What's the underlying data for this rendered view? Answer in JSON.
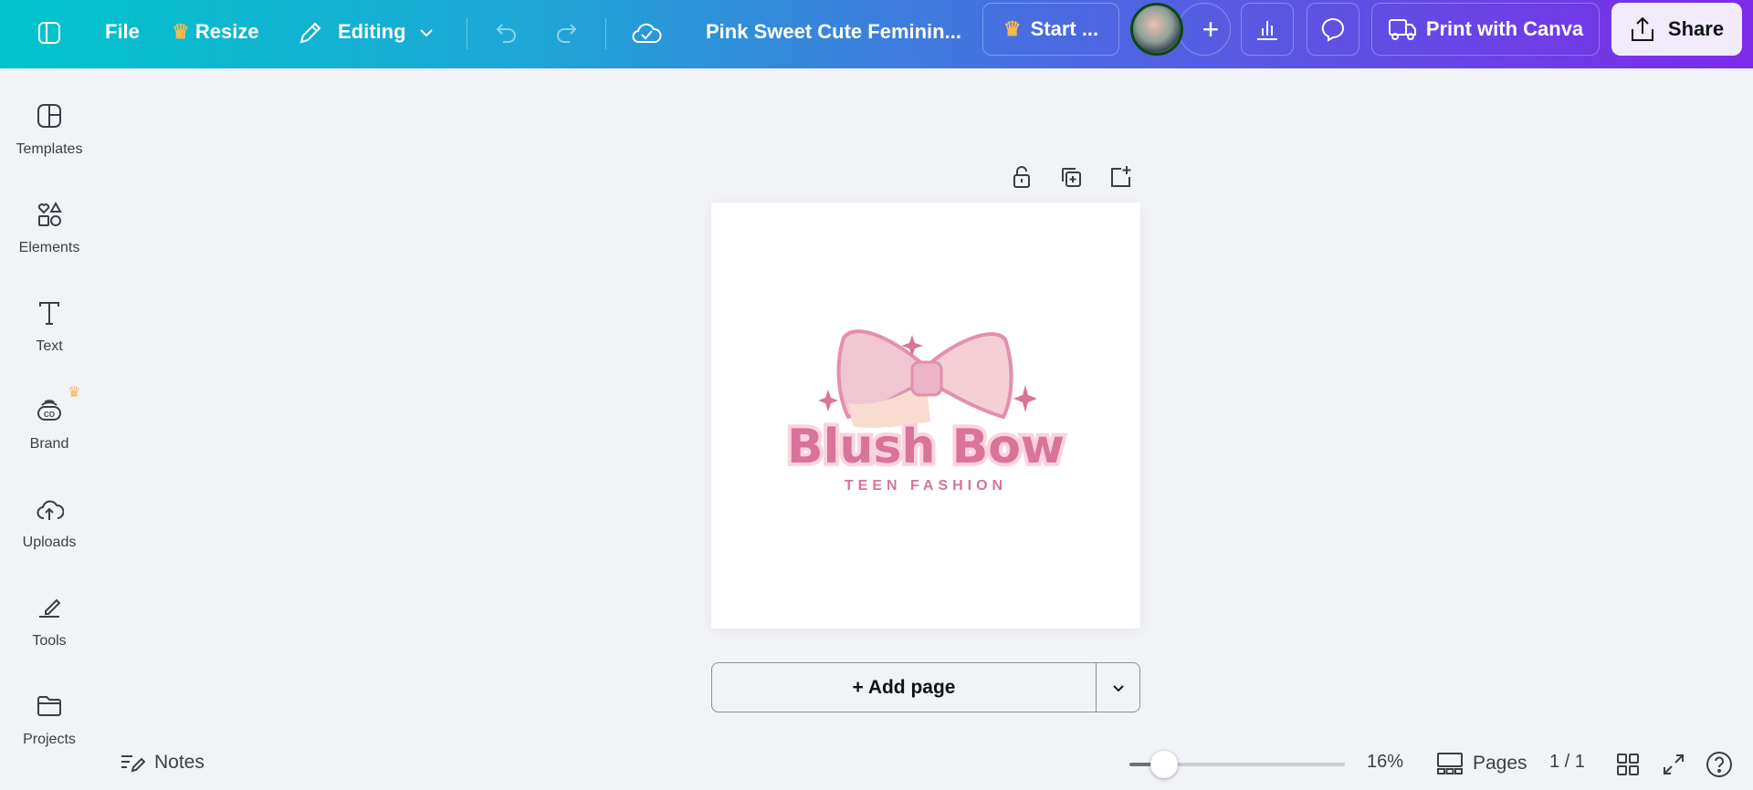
{
  "topbar": {
    "file_label": "File",
    "resize_label": "Resize",
    "mode_label": "Editing",
    "document_title": "Pink Sweet Cute Feminin...",
    "start_label": "Start ...",
    "print_label": "Print with Canva",
    "share_label": "Share"
  },
  "sidebar": {
    "items": [
      {
        "label": "Templates"
      },
      {
        "label": "Elements"
      },
      {
        "label": "Text"
      },
      {
        "label": "Brand"
      },
      {
        "label": "Uploads"
      },
      {
        "label": "Tools"
      },
      {
        "label": "Projects"
      }
    ]
  },
  "canvas": {
    "logo_title": "Blush Bow",
    "logo_subtitle": "TEEN FASHION",
    "add_page_label": "+ Add page"
  },
  "bottombar": {
    "notes_label": "Notes",
    "zoom_value": "16%",
    "zoom_fraction": 0.16,
    "pages_label": "Pages",
    "page_count": "1 / 1"
  },
  "colors": {
    "logo_pink": "#d9739a",
    "crown": "#f8b84e"
  }
}
